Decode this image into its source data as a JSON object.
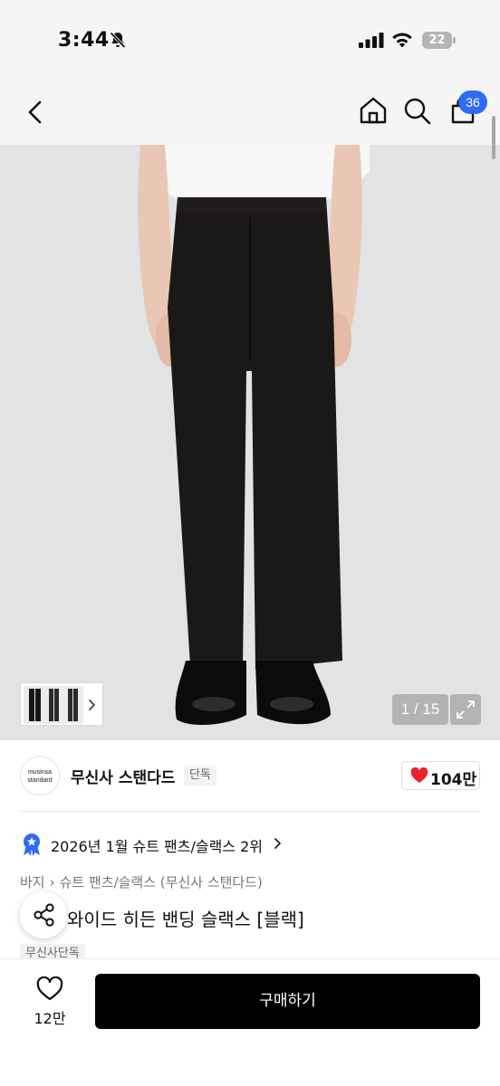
{
  "status_bar": {
    "time": "3:44",
    "battery": "22"
  },
  "header": {
    "cart_count": "36"
  },
  "gallery": {
    "counter": "1 / 15"
  },
  "brand": {
    "logo_line1": "musinsa",
    "logo_line2": "standard",
    "name": "무신사 스탠다드",
    "tag": "단독",
    "likes": "104만",
    "like_color": "#e8222a"
  },
  "ranking": {
    "text": "2026년 1월 슈트 팬츠/슬랙스 2위"
  },
  "breadcrumb": {
    "level1": "바지",
    "level2": "슈트 팬츠/슬랙스 (무신사 스탠다드)"
  },
  "product": {
    "title": "와이드 히든 밴딩 슬랙스 [블랙]",
    "badge": "무신사단독"
  },
  "bottom_bar": {
    "wish_count": "12만",
    "buy_label": "구매하기"
  },
  "colors": {
    "accent": "#2f6bf5",
    "buy_button": "#000000"
  }
}
